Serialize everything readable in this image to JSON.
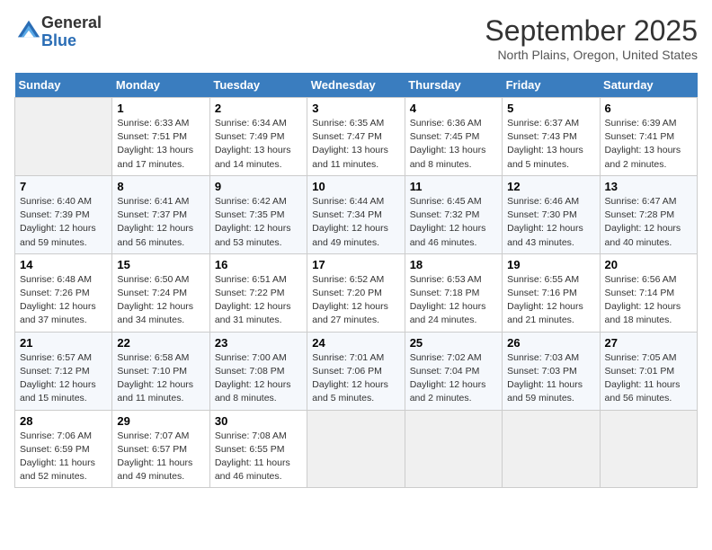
{
  "header": {
    "logo_general": "General",
    "logo_blue": "Blue",
    "month_title": "September 2025",
    "location": "North Plains, Oregon, United States"
  },
  "days_of_week": [
    "Sunday",
    "Monday",
    "Tuesday",
    "Wednesday",
    "Thursday",
    "Friday",
    "Saturday"
  ],
  "weeks": [
    [
      {
        "day": "",
        "empty": true
      },
      {
        "day": "1",
        "sunrise": "Sunrise: 6:33 AM",
        "sunset": "Sunset: 7:51 PM",
        "daylight": "Daylight: 13 hours and 17 minutes."
      },
      {
        "day": "2",
        "sunrise": "Sunrise: 6:34 AM",
        "sunset": "Sunset: 7:49 PM",
        "daylight": "Daylight: 13 hours and 14 minutes."
      },
      {
        "day": "3",
        "sunrise": "Sunrise: 6:35 AM",
        "sunset": "Sunset: 7:47 PM",
        "daylight": "Daylight: 13 hours and 11 minutes."
      },
      {
        "day": "4",
        "sunrise": "Sunrise: 6:36 AM",
        "sunset": "Sunset: 7:45 PM",
        "daylight": "Daylight: 13 hours and 8 minutes."
      },
      {
        "day": "5",
        "sunrise": "Sunrise: 6:37 AM",
        "sunset": "Sunset: 7:43 PM",
        "daylight": "Daylight: 13 hours and 5 minutes."
      },
      {
        "day": "6",
        "sunrise": "Sunrise: 6:39 AM",
        "sunset": "Sunset: 7:41 PM",
        "daylight": "Daylight: 13 hours and 2 minutes."
      }
    ],
    [
      {
        "day": "7",
        "sunrise": "Sunrise: 6:40 AM",
        "sunset": "Sunset: 7:39 PM",
        "daylight": "Daylight: 12 hours and 59 minutes."
      },
      {
        "day": "8",
        "sunrise": "Sunrise: 6:41 AM",
        "sunset": "Sunset: 7:37 PM",
        "daylight": "Daylight: 12 hours and 56 minutes."
      },
      {
        "day": "9",
        "sunrise": "Sunrise: 6:42 AM",
        "sunset": "Sunset: 7:35 PM",
        "daylight": "Daylight: 12 hours and 53 minutes."
      },
      {
        "day": "10",
        "sunrise": "Sunrise: 6:44 AM",
        "sunset": "Sunset: 7:34 PM",
        "daylight": "Daylight: 12 hours and 49 minutes."
      },
      {
        "day": "11",
        "sunrise": "Sunrise: 6:45 AM",
        "sunset": "Sunset: 7:32 PM",
        "daylight": "Daylight: 12 hours and 46 minutes."
      },
      {
        "day": "12",
        "sunrise": "Sunrise: 6:46 AM",
        "sunset": "Sunset: 7:30 PM",
        "daylight": "Daylight: 12 hours and 43 minutes."
      },
      {
        "day": "13",
        "sunrise": "Sunrise: 6:47 AM",
        "sunset": "Sunset: 7:28 PM",
        "daylight": "Daylight: 12 hours and 40 minutes."
      }
    ],
    [
      {
        "day": "14",
        "sunrise": "Sunrise: 6:48 AM",
        "sunset": "Sunset: 7:26 PM",
        "daylight": "Daylight: 12 hours and 37 minutes."
      },
      {
        "day": "15",
        "sunrise": "Sunrise: 6:50 AM",
        "sunset": "Sunset: 7:24 PM",
        "daylight": "Daylight: 12 hours and 34 minutes."
      },
      {
        "day": "16",
        "sunrise": "Sunrise: 6:51 AM",
        "sunset": "Sunset: 7:22 PM",
        "daylight": "Daylight: 12 hours and 31 minutes."
      },
      {
        "day": "17",
        "sunrise": "Sunrise: 6:52 AM",
        "sunset": "Sunset: 7:20 PM",
        "daylight": "Daylight: 12 hours and 27 minutes."
      },
      {
        "day": "18",
        "sunrise": "Sunrise: 6:53 AM",
        "sunset": "Sunset: 7:18 PM",
        "daylight": "Daylight: 12 hours and 24 minutes."
      },
      {
        "day": "19",
        "sunrise": "Sunrise: 6:55 AM",
        "sunset": "Sunset: 7:16 PM",
        "daylight": "Daylight: 12 hours and 21 minutes."
      },
      {
        "day": "20",
        "sunrise": "Sunrise: 6:56 AM",
        "sunset": "Sunset: 7:14 PM",
        "daylight": "Daylight: 12 hours and 18 minutes."
      }
    ],
    [
      {
        "day": "21",
        "sunrise": "Sunrise: 6:57 AM",
        "sunset": "Sunset: 7:12 PM",
        "daylight": "Daylight: 12 hours and 15 minutes."
      },
      {
        "day": "22",
        "sunrise": "Sunrise: 6:58 AM",
        "sunset": "Sunset: 7:10 PM",
        "daylight": "Daylight: 12 hours and 11 minutes."
      },
      {
        "day": "23",
        "sunrise": "Sunrise: 7:00 AM",
        "sunset": "Sunset: 7:08 PM",
        "daylight": "Daylight: 12 hours and 8 minutes."
      },
      {
        "day": "24",
        "sunrise": "Sunrise: 7:01 AM",
        "sunset": "Sunset: 7:06 PM",
        "daylight": "Daylight: 12 hours and 5 minutes."
      },
      {
        "day": "25",
        "sunrise": "Sunrise: 7:02 AM",
        "sunset": "Sunset: 7:04 PM",
        "daylight": "Daylight: 12 hours and 2 minutes."
      },
      {
        "day": "26",
        "sunrise": "Sunrise: 7:03 AM",
        "sunset": "Sunset: 7:03 PM",
        "daylight": "Daylight: 11 hours and 59 minutes."
      },
      {
        "day": "27",
        "sunrise": "Sunrise: 7:05 AM",
        "sunset": "Sunset: 7:01 PM",
        "daylight": "Daylight: 11 hours and 56 minutes."
      }
    ],
    [
      {
        "day": "28",
        "sunrise": "Sunrise: 7:06 AM",
        "sunset": "Sunset: 6:59 PM",
        "daylight": "Daylight: 11 hours and 52 minutes."
      },
      {
        "day": "29",
        "sunrise": "Sunrise: 7:07 AM",
        "sunset": "Sunset: 6:57 PM",
        "daylight": "Daylight: 11 hours and 49 minutes."
      },
      {
        "day": "30",
        "sunrise": "Sunrise: 7:08 AM",
        "sunset": "Sunset: 6:55 PM",
        "daylight": "Daylight: 11 hours and 46 minutes."
      },
      {
        "day": "",
        "empty": true
      },
      {
        "day": "",
        "empty": true
      },
      {
        "day": "",
        "empty": true
      },
      {
        "day": "",
        "empty": true
      }
    ]
  ]
}
